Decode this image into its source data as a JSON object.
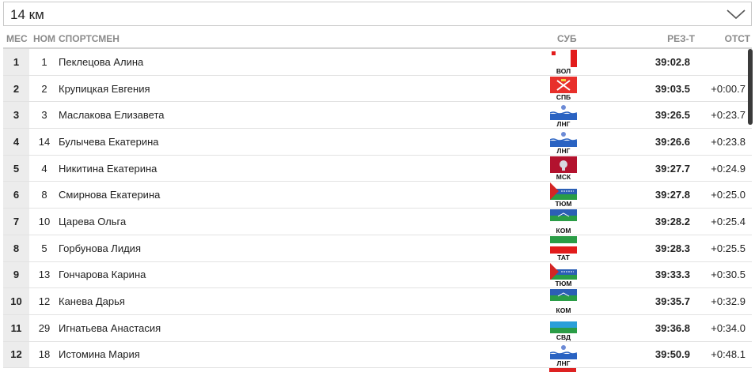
{
  "distance": {
    "selected": "14 км"
  },
  "columns": {
    "place": "МЕС",
    "num": "НОМ",
    "athlete": "СПОРТСМЕН",
    "region": "СУБ",
    "result": "РЕЗ-Т",
    "gap": "ОТСТ"
  },
  "rows": [
    {
      "place": "1",
      "num": "1",
      "name": "Пеклецова Алина",
      "region": "ВОЛ",
      "result": "39:02.8",
      "gap": ""
    },
    {
      "place": "2",
      "num": "2",
      "name": "Крупицкая Евгения",
      "region": "СПБ",
      "result": "39:03.5",
      "gap": "+0:00.7"
    },
    {
      "place": "3",
      "num": "3",
      "name": "Маслакова Елизавета",
      "region": "ЛНГ",
      "result": "39:26.5",
      "gap": "+0:23.7"
    },
    {
      "place": "4",
      "num": "14",
      "name": "Булычева Екатерина",
      "region": "ЛНГ",
      "result": "39:26.6",
      "gap": "+0:23.8"
    },
    {
      "place": "5",
      "num": "4",
      "name": "Никитина Екатерина",
      "region": "МСК",
      "result": "39:27.7",
      "gap": "+0:24.9"
    },
    {
      "place": "6",
      "num": "8",
      "name": "Смирнова Екатерина",
      "region": "ТЮМ",
      "result": "39:27.8",
      "gap": "+0:25.0"
    },
    {
      "place": "7",
      "num": "10",
      "name": "Царева Ольга",
      "region": "КОМ",
      "result": "39:28.2",
      "gap": "+0:25.4"
    },
    {
      "place": "8",
      "num": "5",
      "name": "Горбунова Лидия",
      "region": "ТАТ",
      "result": "39:28.3",
      "gap": "+0:25.5"
    },
    {
      "place": "9",
      "num": "13",
      "name": "Гончарова Карина",
      "region": "ТЮМ",
      "result": "39:33.3",
      "gap": "+0:30.5"
    },
    {
      "place": "10",
      "num": "12",
      "name": "Канева Дарья",
      "region": "КОМ",
      "result": "39:35.7",
      "gap": "+0:32.9"
    },
    {
      "place": "11",
      "num": "29",
      "name": "Игнатьева Анастасия",
      "region": "СВД",
      "result": "39:36.8",
      "gap": "+0:34.0"
    },
    {
      "place": "12",
      "num": "18",
      "name": "Истомина Мария",
      "region": "ЛНГ",
      "result": "39:50.9",
      "gap": "+0:48.1"
    }
  ],
  "flags": {
    "ВОЛ": {
      "icon": "vologda-flag-icon"
    },
    "СПБ": {
      "icon": "spb-flag-icon"
    },
    "ЛНГ": {
      "icon": "leningrad-flag-icon"
    },
    "МСК": {
      "icon": "moscow-flag-icon"
    },
    "ТЮМ": {
      "icon": "tyumen-flag-icon"
    },
    "КОМ": {
      "icon": "komi-flag-icon"
    },
    "ТАТ": {
      "icon": "tatarstan-flag-icon"
    },
    "СВД": {
      "icon": "sverdlovsk-flag-icon"
    }
  }
}
